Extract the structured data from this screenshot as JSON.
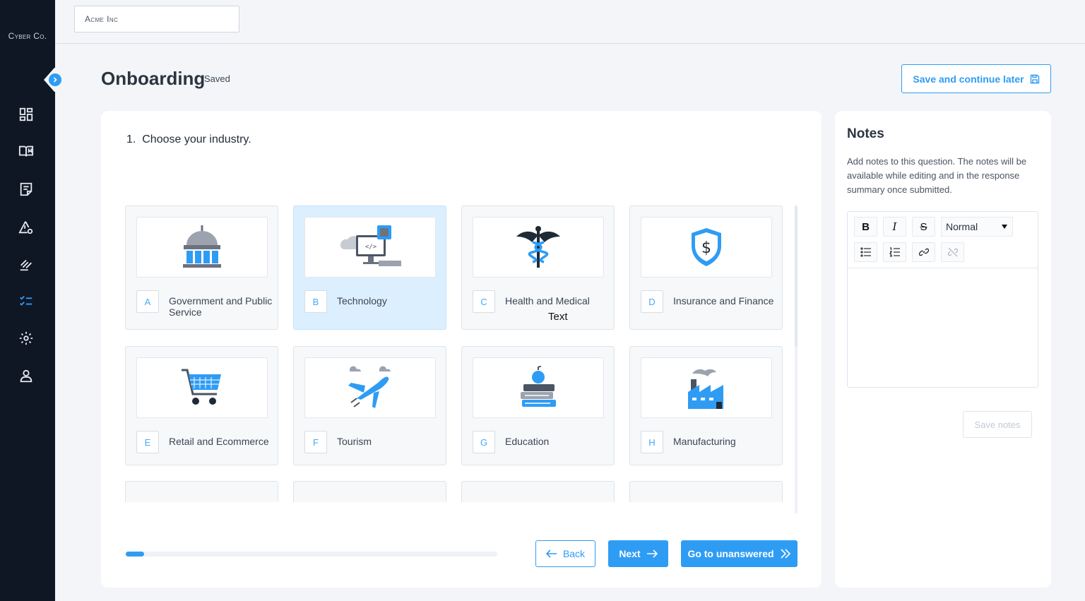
{
  "brand": "Cyber Co.",
  "header": {
    "org_name": "Acme Inc"
  },
  "page": {
    "title": "Onboarding",
    "status": "Saved",
    "save_later_label": "Save and continue later"
  },
  "question": {
    "number": "1.",
    "text": "Choose your industry."
  },
  "options": [
    {
      "letter": "A",
      "label": "Government and Public Service",
      "icon": "government-building-icon",
      "selected": false
    },
    {
      "letter": "B",
      "label": "Technology",
      "icon": "computer-chip-icon",
      "selected": true
    },
    {
      "letter": "C",
      "label": "Health and Medical",
      "icon": "caduceus-icon",
      "selected": false
    },
    {
      "letter": "D",
      "label": "Insurance and Finance",
      "icon": "shield-dollar-icon",
      "selected": false
    },
    {
      "letter": "E",
      "label": "Retail and Ecommerce",
      "icon": "shopping-cart-icon",
      "selected": false
    },
    {
      "letter": "F",
      "label": "Tourism",
      "icon": "airplane-icon",
      "selected": false
    },
    {
      "letter": "G",
      "label": "Education",
      "icon": "books-apple-icon",
      "selected": false
    },
    {
      "letter": "H",
      "label": "Manufacturing",
      "icon": "factory-icon",
      "selected": false
    }
  ],
  "tooltip": "Text",
  "progress": {
    "fraction": 0.05
  },
  "nav": {
    "back_label": "Back",
    "next_label": "Next",
    "unanswered_label": "Go to unanswered"
  },
  "notes": {
    "title": "Notes",
    "description": "Add notes to this question. The notes will be available while editing and in the response summary once submitted.",
    "format_select": "Normal",
    "save_label": "Save notes"
  },
  "colors": {
    "accent": "#2f9cf4",
    "sidebar": "#0f1724",
    "selected_bg": "#dcefff"
  }
}
